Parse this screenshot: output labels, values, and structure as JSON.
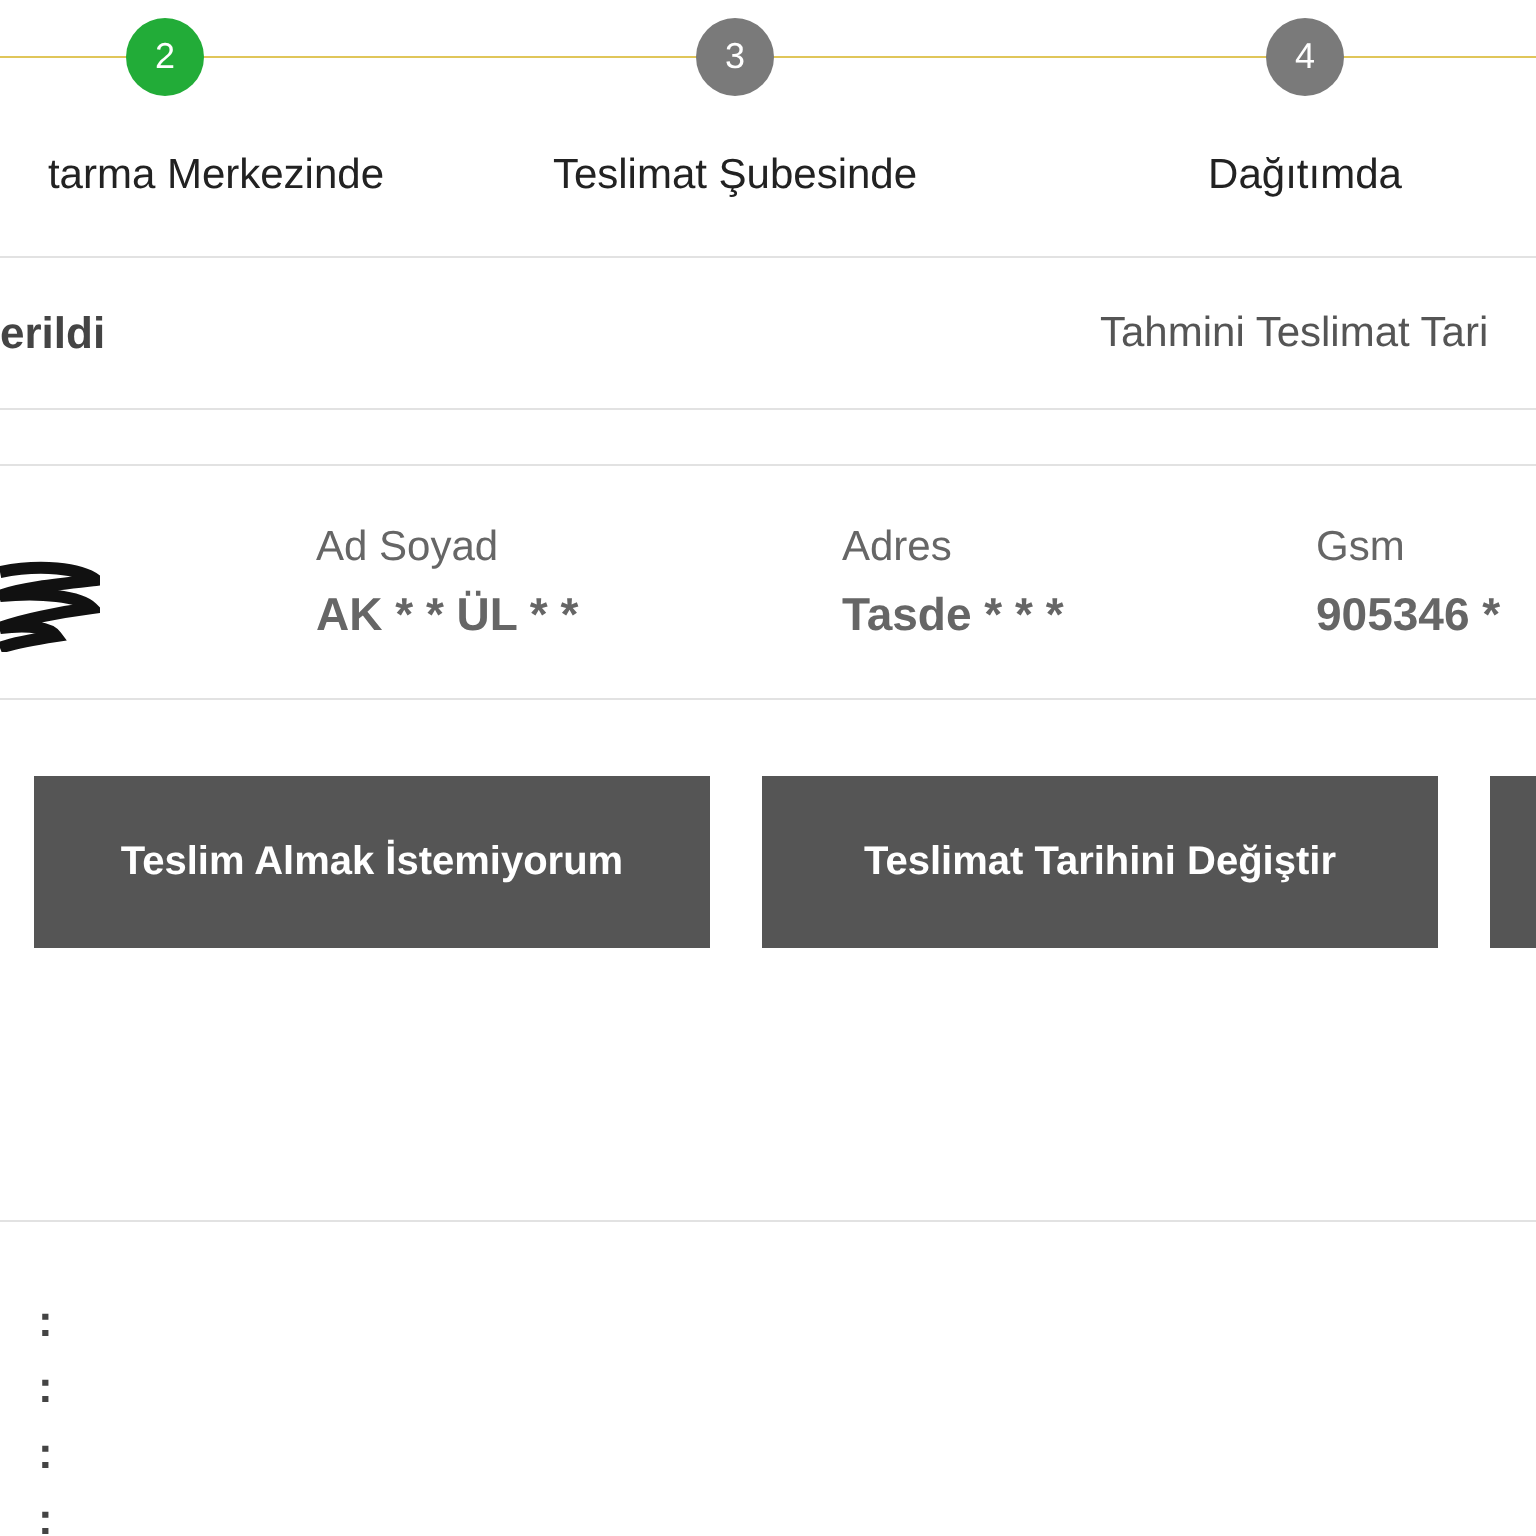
{
  "steps": [
    {
      "number": "2",
      "label": "tarma Merkezinde",
      "active": true
    },
    {
      "number": "3",
      "label": "Teslimat Şubesinde",
      "active": false
    },
    {
      "number": "4",
      "label": "Dağıtımda",
      "active": false
    }
  ],
  "status": {
    "text": "erildi",
    "estimated_label": "Tahmini Teslimat Tari"
  },
  "recipient": [
    {
      "label": "Ad Soyad",
      "value": "AK * * ÜL * *"
    },
    {
      "label": "Adres",
      "value": "Tasde * * *"
    },
    {
      "label": "Gsm",
      "value": "905346 *"
    }
  ],
  "buttons": [
    "Teslim Almak İstemiyorum",
    "Teslimat Tarihini Değiştir"
  ],
  "details": [
    ":",
    ":",
    ":",
    ":"
  ]
}
